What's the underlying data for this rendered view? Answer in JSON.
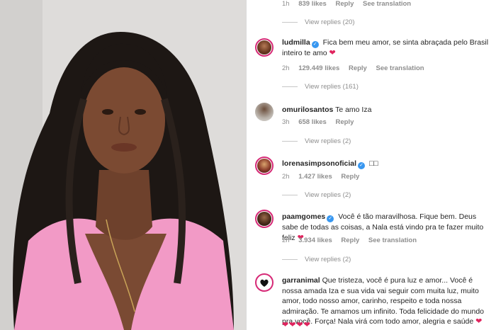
{
  "top": {
    "time": "1h",
    "likes": "839 likes",
    "reply": "Reply",
    "see_translation": "See translation"
  },
  "comments": [
    {
      "view_replies": "View replies (20)"
    },
    {
      "username": "ludmilla",
      "text": "Fica bem meu amor, se sinta abraçada pelo Brasil inteiro te amo",
      "time": "2h",
      "likes": "129.449 likes",
      "reply": "Reply",
      "see_translation": "See translation",
      "view_replies": "View replies (161)"
    },
    {
      "username": "omurilosantos",
      "text": "Te amo Iza",
      "time": "3h",
      "likes": "658 likes",
      "reply": "Reply",
      "view_replies": "View replies (2)"
    },
    {
      "username": "lorenasimpsonoficial",
      "text": "□□",
      "time": "2h",
      "likes": "1.427 likes",
      "reply": "Reply",
      "view_replies": "View replies (2)"
    },
    {
      "username": "paamgomes",
      "text": "Você é tão maravilhosa. Fique bem. Deus sabe de todas as coisas, a Nala está vindo pra te fazer muito feliz",
      "time": "2h",
      "likes": "3.934 likes",
      "reply": "Reply",
      "see_translation": "See translation",
      "view_replies": "View replies (2)"
    },
    {
      "username": "garranimal",
      "text": "Que tristeza, você é pura luz e amor... Você é nossa amada Iza e sua vida vai seguir com muita luz, muito amor, todo nosso amor, carinho, respeito e toda nossa admiração. Te amamos um infinito. Toda felicidade do mundo pra você. Força! Nala virá com todo amor, alegria e saúde"
    }
  ],
  "colors": {
    "verified": "#3897f0",
    "heart": "#e0245e",
    "ring": "#d62976",
    "meta": "#8e8e8e"
  }
}
